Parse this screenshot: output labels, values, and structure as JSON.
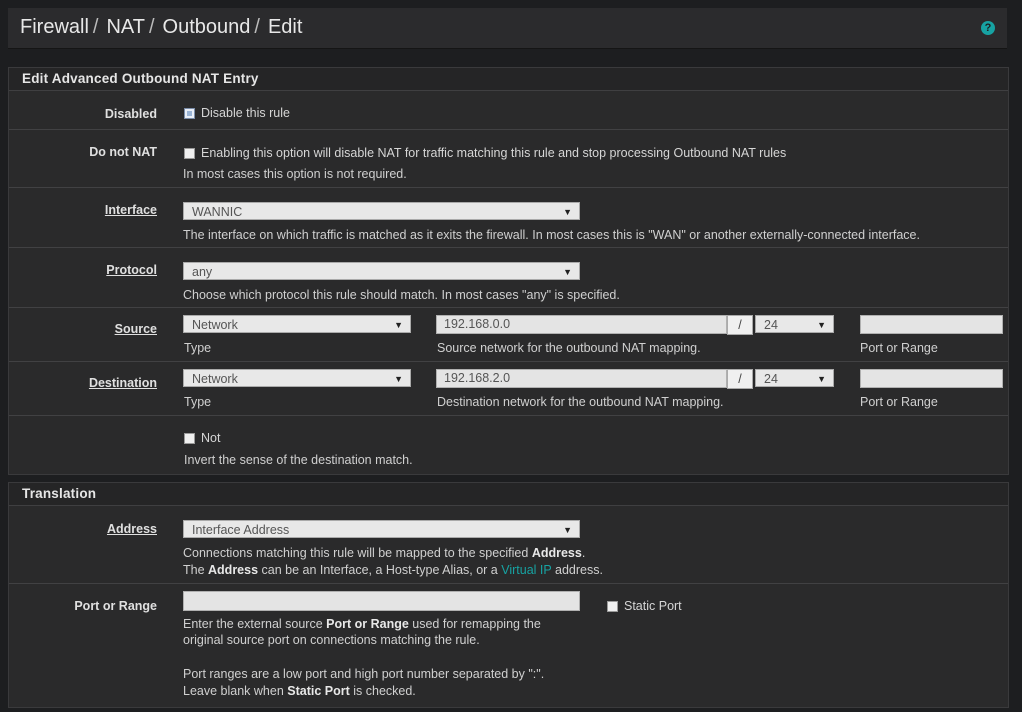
{
  "breadcrumb": [
    "Firewall",
    "NAT",
    "Outbound",
    "Edit"
  ],
  "panel1": {
    "title": "Edit Advanced Outbound NAT Entry",
    "disabled": {
      "label": "Disabled",
      "checkbox_label": "Disable this rule",
      "checked": true
    },
    "donotnat": {
      "label": "Do not NAT",
      "checkbox_label": "Enabling this option will disable NAT for traffic matching this rule and stop processing Outbound NAT rules",
      "help": "In most cases this option is not required.",
      "checked": false
    },
    "interface": {
      "label": "Interface",
      "value": "WANNIC",
      "help": "The interface on which traffic is matched as it exits the firewall. In most cases this is \"WAN\" or another externally-connected interface."
    },
    "protocol": {
      "label": "Protocol",
      "value": "any",
      "help": "Choose which protocol this rule should match. In most cases \"any\" is specified."
    },
    "source": {
      "label": "Source",
      "type_value": "Network",
      "type_help": "Type",
      "network": "192.168.0.0",
      "slash": "/",
      "mask": "24",
      "network_help": "Source network for the outbound NAT mapping.",
      "port_value": "",
      "port_help": "Port or Range"
    },
    "destination": {
      "label": "Destination",
      "type_value": "Network",
      "type_help": "Type",
      "network": "192.168.2.0",
      "slash": "/",
      "mask": "24",
      "network_help": "Destination network for the outbound NAT mapping.",
      "port_value": "",
      "port_help": "Port or Range"
    },
    "not": {
      "checkbox_label": "Not",
      "help": "Invert the sense of the destination match.",
      "checked": false
    }
  },
  "panel2": {
    "title": "Translation",
    "address": {
      "label": "Address",
      "value": "Interface Address",
      "help1_pre": "Connections matching this rule will be mapped to the specified ",
      "help1_bold": "Address",
      "help1_post": ".",
      "help2_pre": "The ",
      "help2_bold": "Address",
      "help2_mid": " can be an Interface, a Host-type Alias, or a ",
      "help2_link": "Virtual IP",
      "help2_post": " address."
    },
    "port": {
      "label": "Port or Range",
      "value": "",
      "static_label": "Static Port",
      "static_checked": false,
      "help1_pre": "Enter the external source ",
      "help1_bold": "Port or Range",
      "help1_post": " used for remapping the",
      "help2": "original source port on connections matching the rule.",
      "help3": "Port ranges are a low port and high port number separated by \":\".",
      "help4_pre": "Leave blank when ",
      "help4_bold": "Static Port",
      "help4_post": " is checked."
    }
  },
  "colors": {
    "accent": "#17a2a2",
    "background": "#1d1e20",
    "panel": "#2a2a2b"
  },
  "icons": {
    "help": "question-circle-icon"
  }
}
